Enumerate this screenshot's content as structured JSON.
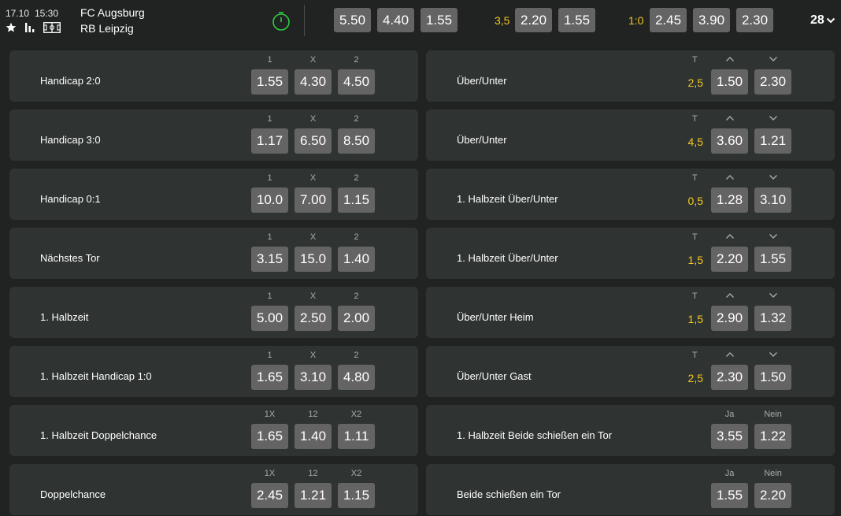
{
  "event": {
    "date": "17.10",
    "time": "15:30",
    "home": "FC Augsburg",
    "away": "RB Leipzig",
    "icons": [
      "star-icon",
      "stats-icon",
      "field-icon",
      "live-timer-icon"
    ],
    "main_odds": [
      "5.50",
      "4.40",
      "1.55"
    ],
    "ou_line": "3,5",
    "ou_odds": [
      "2.20",
      "1.55"
    ],
    "hc_line": "1:0",
    "hc_odds": [
      "2.45",
      "3.90",
      "2.30"
    ],
    "more_count": "28"
  },
  "left_markets": [
    {
      "name": "Handicap 2:0",
      "headers": [
        "1",
        "X",
        "2"
      ],
      "odds": [
        "1.55",
        "4.30",
        "4.50"
      ]
    },
    {
      "name": "Handicap 3:0",
      "headers": [
        "1",
        "X",
        "2"
      ],
      "odds": [
        "1.17",
        "6.50",
        "8.50"
      ]
    },
    {
      "name": "Handicap 0:1",
      "headers": [
        "1",
        "X",
        "2"
      ],
      "odds": [
        "10.0",
        "7.00",
        "1.15"
      ]
    },
    {
      "name": "Nächstes Tor",
      "headers": [
        "1",
        "X",
        "2"
      ],
      "odds": [
        "3.15",
        "15.0",
        "1.40"
      ]
    },
    {
      "name": "1. Halbzeit",
      "headers": [
        "1",
        "X",
        "2"
      ],
      "odds": [
        "5.00",
        "2.50",
        "2.00"
      ]
    },
    {
      "name": "1. Halbzeit Handicap 1:0",
      "headers": [
        "1",
        "X",
        "2"
      ],
      "odds": [
        "1.65",
        "3.10",
        "4.80"
      ]
    },
    {
      "name": "1. Halbzeit Doppelchance",
      "headers": [
        "1X",
        "12",
        "X2"
      ],
      "odds": [
        "1.65",
        "1.40",
        "1.11"
      ]
    },
    {
      "name": "Doppelchance",
      "headers": [
        "1X",
        "12",
        "X2"
      ],
      "odds": [
        "2.45",
        "1.21",
        "1.15"
      ]
    }
  ],
  "right_markets": [
    {
      "name": "Über/Unter",
      "type": "ou",
      "t_label": "T",
      "line": "2,5",
      "odds": [
        "1.50",
        "2.30"
      ]
    },
    {
      "name": "Über/Unter",
      "type": "ou",
      "t_label": "T",
      "line": "4,5",
      "odds": [
        "3.60",
        "1.21"
      ]
    },
    {
      "name": "1. Halbzeit Über/Unter",
      "type": "ou",
      "t_label": "T",
      "line": "0,5",
      "odds": [
        "1.28",
        "3.10"
      ]
    },
    {
      "name": "1. Halbzeit Über/Unter",
      "type": "ou",
      "t_label": "T",
      "line": "1,5",
      "odds": [
        "2.20",
        "1.55"
      ]
    },
    {
      "name": "Über/Unter Heim",
      "type": "ou",
      "t_label": "T",
      "line": "1,5",
      "odds": [
        "2.90",
        "1.32"
      ]
    },
    {
      "name": "Über/Unter Gast",
      "type": "ou",
      "t_label": "T",
      "line": "2,5",
      "odds": [
        "2.30",
        "1.50"
      ]
    },
    {
      "name": "1. Halbzeit Beide schießen ein Tor",
      "type": "yn",
      "headers": [
        "Ja",
        "Nein"
      ],
      "odds": [
        "3.55",
        "1.22"
      ]
    },
    {
      "name": "Beide schießen ein Tor",
      "type": "yn",
      "headers": [
        "Ja",
        "Nein"
      ],
      "odds": [
        "1.55",
        "2.20"
      ]
    }
  ],
  "colors": {
    "background": "#202322",
    "card": "#2f3432",
    "odd_button": "#646464",
    "line_accent": "#f3c623",
    "live_green": "#2ecc40",
    "header_label": "#a8aaa9"
  }
}
